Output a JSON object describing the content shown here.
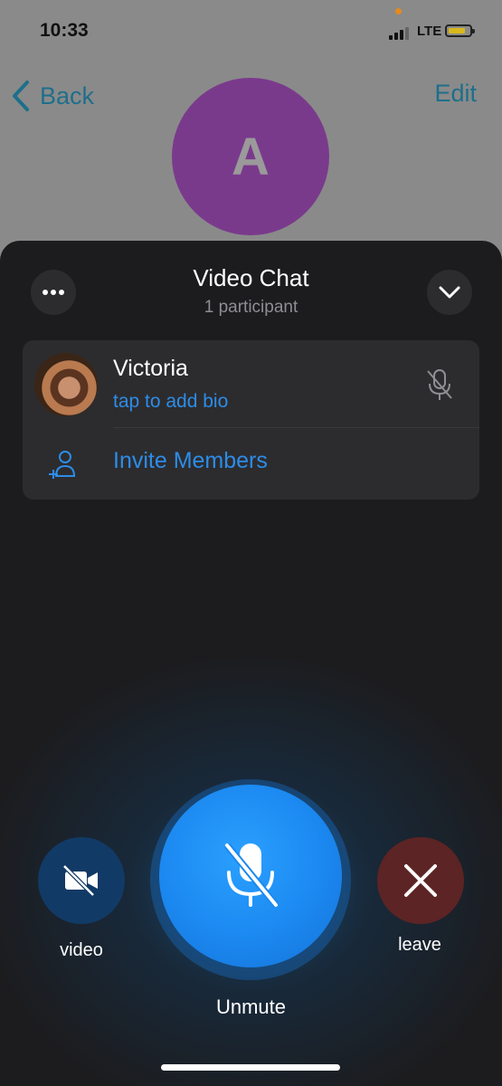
{
  "status_bar": {
    "time": "10:33",
    "network": "LTE"
  },
  "profile": {
    "back_label": "Back",
    "edit_label": "Edit",
    "avatar_initial": "A",
    "avatar_color": "#7a3a8c"
  },
  "sheet": {
    "title": "Video Chat",
    "subtitle": "1 participant",
    "more_icon": "ellipsis-icon",
    "collapse_icon": "chevron-down-icon"
  },
  "participants": [
    {
      "name": "Victoria",
      "bio": "tap to add bio",
      "mic_icon": "mic-off-icon"
    }
  ],
  "invite": {
    "label": "Invite Members",
    "icon": "add-person-icon"
  },
  "controls": {
    "video_label": "video",
    "main_label": "Unmute",
    "leave_label": "leave"
  },
  "colors": {
    "accent": "#2d8ce8",
    "main_button": "#1b88f0",
    "leave_button": "#5c2424",
    "video_button": "#123a66"
  }
}
